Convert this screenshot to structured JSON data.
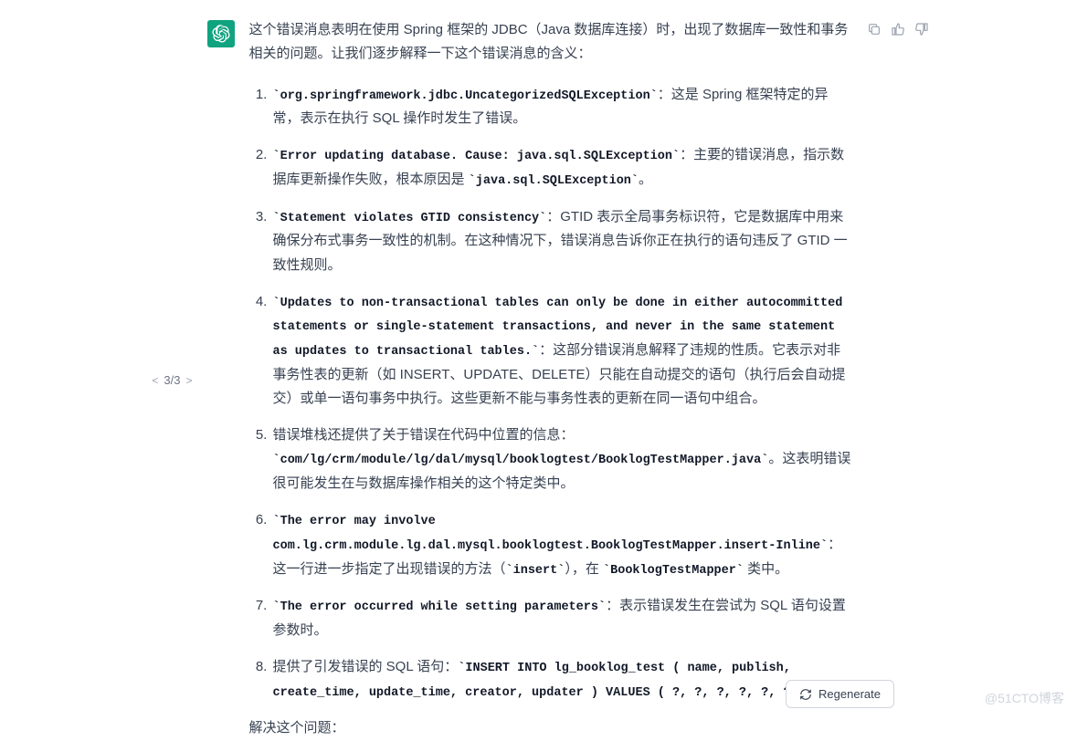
{
  "nav": {
    "prev": "<",
    "counter": "3/3",
    "next": ">"
  },
  "intro": "这个错误消息表明在使用 Spring 框架的 JDBC（Java 数据库连接）时，出现了数据库一致性和事务相关的问题。让我们逐步解释一下这个错误消息的含义：",
  "items": {
    "i1": {
      "code": "org.springframework.jdbc.UncategorizedSQLException",
      "after": "：这是 Spring 框架特定的异常，表示在执行 SQL 操作时发生了错误。"
    },
    "i2": {
      "code": "Error updating database. Cause: java.sql.SQLException",
      "mid": "：主要的错误消息，指示数据库更新操作失败，根本原因是 ",
      "code2": "java.sql.SQLException",
      "end": "。"
    },
    "i3": {
      "code": "Statement violates GTID consistency",
      "after": "：GTID 表示全局事务标识符，它是数据库中用来确保分布式事务一致性的机制。在这种情况下，错误消息告诉你正在执行的语句违反了 GTID 一致性规则。"
    },
    "i4": {
      "code": "Updates to non-transactional tables can only be done in either autocommitted statements or single-statement transactions, and never in the same statement as updates to transactional tables.",
      "after": "：这部分错误消息解释了违规的性质。它表示对非事务性表的更新（如 INSERT、UPDATE、DELETE）只能在自动提交的语句（执行后会自动提交）或单一语句事务中执行。这些更新不能与事务性表的更新在同一语句中组合。"
    },
    "i5": {
      "pre": "错误堆栈还提供了关于错误在代码中位置的信息：",
      "code": "com/lg/crm/module/lg/dal/mysql/booklogtest/BooklogTestMapper.java",
      "after": "。这表明错误很可能发生在与数据库操作相关的这个特定类中。"
    },
    "i6": {
      "code": "The error may involve com.lg.crm.module.lg.dal.mysql.booklogtest.BooklogTestMapper.insert-Inline",
      "mid": "：这一行进一步指定了出现错误的方法（",
      "code2": "insert",
      "mid2": "），在 ",
      "code3": "BooklogTestMapper",
      "end": " 类中。"
    },
    "i7": {
      "code": "The error occurred while setting parameters",
      "after": "：表示错误发生在尝试为 SQL 语句设置参数时。"
    },
    "i8": {
      "pre": "提供了引发错误的 SQL 语句：",
      "code": "INSERT INTO lg_booklog_test ( name, publish, create_time, update_time, creator, updater ) VALUES ( ?, ?, ?, ?, ?, ? )",
      "after": "。"
    }
  },
  "closing": "解决这个问题：",
  "regenerate_label": "Regenerate",
  "watermark": "@51CTO博客"
}
